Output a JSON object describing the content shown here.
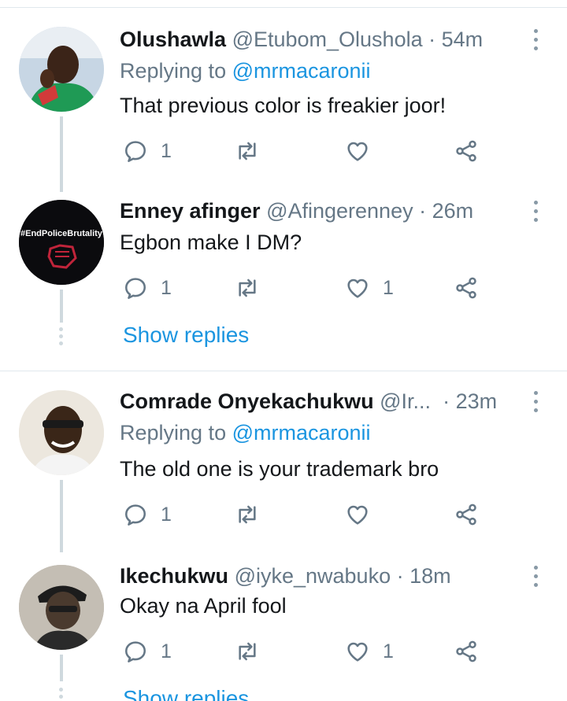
{
  "tweets": [
    {
      "name": "Olushawla",
      "handle": "@Etubom_Olushola",
      "time": "54m",
      "replying_label": "Replying to",
      "replying_handle": "@mrmacaronii",
      "text": "That previous color is freakier joor!",
      "replies": "1",
      "retweets": "",
      "likes": ""
    },
    {
      "name": "Enney afinger",
      "handle": "@Afingerenney",
      "time": "26m",
      "avatar_text": "#EndPoliceBrutality",
      "text": "Egbon make I DM?",
      "replies": "1",
      "retweets": "",
      "likes": "1",
      "show_replies": "Show replies"
    },
    {
      "name": "Comrade Onyekachukwu",
      "handle": "@Ir...",
      "time": "23m",
      "replying_label": "Replying to",
      "replying_handle": "@mrmacaronii",
      "text": "The old one is your trademark bro",
      "replies": "1",
      "retweets": "",
      "likes": ""
    },
    {
      "name": "Ikechukwu",
      "handle": "@iyke_nwabuko",
      "time": "18m",
      "text": "Okay na April fool",
      "replies": "1",
      "retweets": "",
      "likes": "1",
      "show_replies": "Show replies"
    }
  ],
  "colors": {
    "link": "#1b95e0",
    "secondary_text": "#657786",
    "thread_line": "#cfd9de"
  },
  "icons": [
    "reply-icon",
    "retweet-icon",
    "like-icon",
    "share-icon",
    "more-icon"
  ]
}
